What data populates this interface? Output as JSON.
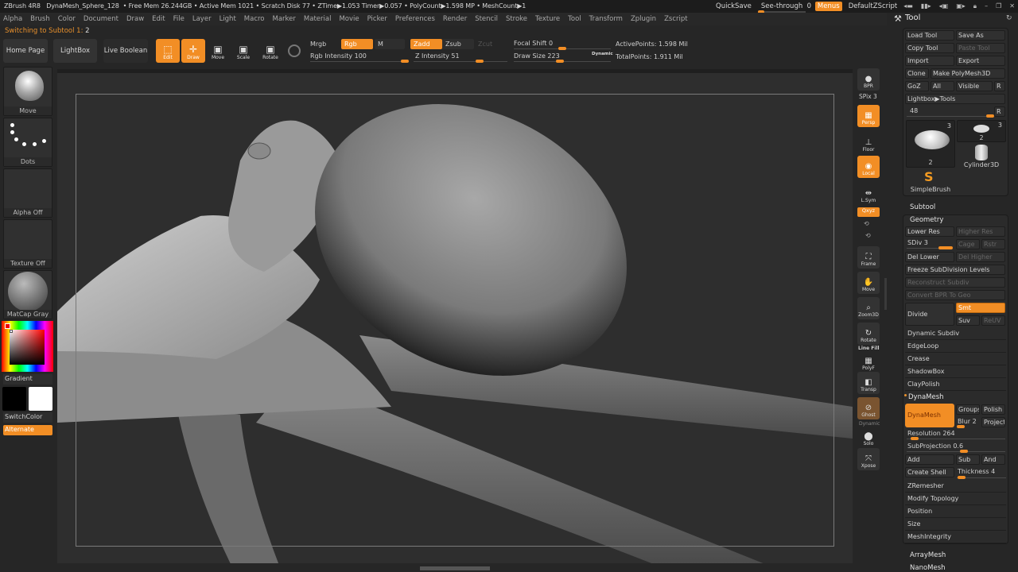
{
  "titlebar": {
    "app": "ZBrush 4R8",
    "doc": "DynaMesh_Sphere_128",
    "stats": "• Free Mem 26.244GB • Active Mem 1021 • Scratch Disk 77 • ZTime▶1.053 Timer▶0.057 • PolyCount▶1.598 MP • MeshCount▶1",
    "quicksave": "QuickSave",
    "seethrough_label": "See-through",
    "seethrough_value": "0",
    "seethrough_fraction": 0.0,
    "menus": "Menus",
    "zscript": "DefaultZScript"
  },
  "menubar": [
    "Alpha",
    "Brush",
    "Color",
    "Document",
    "Draw",
    "Edit",
    "File",
    "Layer",
    "Light",
    "Macro",
    "Marker",
    "Material",
    "Movie",
    "Picker",
    "Preferences",
    "Render",
    "Stencil",
    "Stroke",
    "Texture",
    "Tool",
    "Transform",
    "Zplugin",
    "Zscript"
  ],
  "status": {
    "text": "Switching to Subtool 1:",
    "value": "2"
  },
  "shelf": {
    "home": "Home Page",
    "lightbox": "LightBox",
    "liveboolean": "Live Boolean",
    "edit": "Edit",
    "draw": "Draw",
    "move": "Move",
    "scale": "Scale",
    "rotate": "Rotate",
    "mrgb": "Mrgb",
    "rgb": "Rgb",
    "m": "M",
    "rgb_intensity_label": "Rgb Intensity",
    "rgb_intensity": "100",
    "zadd": "Zadd",
    "zsub": "Zsub",
    "zcut": "Zcut",
    "z_intensity_label": "Z Intensity",
    "z_intensity": "51",
    "focal_label": "Focal Shift",
    "focal": "0",
    "draw_size_label": "Draw Size",
    "draw_size": "223",
    "dynamic": "Dynamic",
    "active_points": "ActivePoints: 1.598 Mil",
    "total_points": "TotalPoints: 1.911 Mil"
  },
  "leftpanel": {
    "brush": "Move",
    "stroke": "Dots",
    "alpha": "Alpha Off",
    "texture": "Texture Off",
    "material": "MatCap Gray",
    "gradient": "Gradient",
    "switchcolor": "SwitchColor",
    "alternate": "Alternate",
    "main_color": "#000000",
    "secondary_color": "#ffffff"
  },
  "rightshelf": {
    "bpr": "BPR",
    "spix": "SPix 3",
    "dynamic": "Dynamic",
    "persp": "Persp",
    "floor": "Floor",
    "local": "Local",
    "lsym": "L.Sym",
    "xyz": "Qxyz",
    "frame": "Frame",
    "move": "Move",
    "zoom3d": "Zoom3D",
    "rotate": "Rotate",
    "linefill": "Line Fill",
    "polyf": "PolyF",
    "transp": "Transp",
    "ghost": "Ghost",
    "dynamic2": "Dynamic",
    "solo": "Solo",
    "xpose": "Xpose"
  },
  "tool": {
    "title": "Tool",
    "load": "Load Tool",
    "saveas": "Save As",
    "copy": "Copy Tool",
    "paste": "Paste Tool",
    "import": "Import",
    "export": "Export",
    "clone": "Clone",
    "make": "Make PolyMesh3D",
    "goz": "GoZ",
    "all": "All",
    "visible": "Visible",
    "r": "R",
    "lightbox_tools": "Lightbox▶Tools",
    "slider_value": "48",
    "thumbs": [
      {
        "label": "2",
        "count": "3"
      },
      {
        "label": "2",
        "count": "3"
      },
      {
        "label": "Cylinder3D",
        "count": ""
      },
      {
        "label": "SimpleBrush",
        "count": ""
      }
    ],
    "subtool": "Subtool",
    "geometry": "Geometry",
    "lower_res": "Lower Res",
    "higher_res": "Higher Res",
    "sdiv": "SDiv 3",
    "cage": "Cage",
    "rstr": "Rstr",
    "del_lower": "Del Lower",
    "del_higher": "Del Higher",
    "freeze": "Freeze SubDivision Levels",
    "reconstruct": "Reconstruct Subdiv",
    "convert": "Convert BPR To Geo",
    "divide": "Divide",
    "smt": "Smt",
    "suv": "Suv",
    "reuv": "ReUV",
    "rows1": [
      "Dynamic Subdiv",
      "EdgeLoop",
      "Crease",
      "ShadowBox",
      "ClayPolish"
    ],
    "dynamesh_section": "DynaMesh",
    "dynamesh_btn": "DynaMesh",
    "groups": "Groups",
    "polish": "Polish",
    "blur": "Blur 2",
    "project": "Project",
    "resolution": "Resolution 264",
    "subprojection": "SubProjection 0.6",
    "add": "Add",
    "sub": "Sub",
    "and": "And",
    "create_shell": "Create Shell",
    "thickness": "Thickness 4",
    "rows2": [
      "ZRemesher",
      "Modify Topology",
      "Position",
      "Size",
      "MeshIntegrity"
    ],
    "arraymesh": "ArrayMesh",
    "nanomesh": "NanoMesh"
  },
  "colors": {
    "accent": "#f28e25",
    "panel": "#262626",
    "viewport": "#2e2e2e"
  }
}
